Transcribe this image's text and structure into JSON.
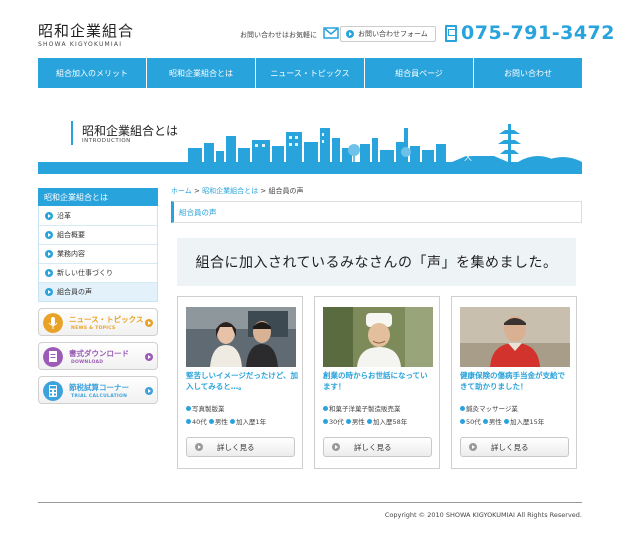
{
  "header": {
    "logo_jp": "昭和企業組合",
    "logo_en": "SHOWA KIGYOKUMIAI",
    "inquiry_text": "お問い合わせはお気軽に",
    "form_button": "お問い合わせフォーム",
    "phone": "075-791-3472"
  },
  "nav": [
    "組合加入のメリット",
    "昭和企業組合とは",
    "ニュース・トピックス",
    "組合員ページ",
    "お問い合わせ"
  ],
  "banner": {
    "title": "昭和企業組合とは",
    "subtitle": "INTRODUCTION",
    "mark": "大"
  },
  "sidebar": {
    "heading": "昭和企業組合とは",
    "items": [
      "沿革",
      "組合概要",
      "業務内容",
      "新しい仕事づくり",
      "組合員の声"
    ],
    "banners": [
      {
        "title": "ニュース・トピックス",
        "sub": "NEWS & TOPICS",
        "color": "#e8a225",
        "icon": "microphone-icon"
      },
      {
        "title": "書式ダウンロード",
        "sub": "DOWNLOAD",
        "color": "#9b5bb7",
        "icon": "document-download-icon"
      },
      {
        "title": "節税試算コーナー",
        "sub": "TRIAL CALCULATION",
        "color": "#3ba2dc",
        "icon": "calculator-icon"
      }
    ]
  },
  "breadcrumb": {
    "home": "ホーム",
    "sep1": ">",
    "parent": "昭和企業組合とは",
    "sep2": ">",
    "current": "組合員の声"
  },
  "section_heading": "組合員の声",
  "catch": "組合に加入されているみなさんの「声」を集めました。",
  "cards": [
    {
      "title": "堅苦しいイメージだったけど、加入してみると…。",
      "business": "写真製版業",
      "age": "40代",
      "gender": "男性",
      "membership": "加入歴1年",
      "button": "詳しく見る"
    },
    {
      "title": "創業の時からお世話になっています！",
      "business": "和菓子洋菓子製造販売業",
      "age": "30代",
      "gender": "男性",
      "membership": "加入歴58年",
      "button": "詳しく見る"
    },
    {
      "title": "健康保険の傷病手当金が支給できて助かりました！",
      "business": "鍼灸マッサージ業",
      "age": "50代",
      "gender": "男性",
      "membership": "加入歴15年",
      "button": "詳しく見る"
    }
  ],
  "footer": {
    "copyright": "Copyright © 2010 SHOWA KIGYOKUMIAI All Rights Reserved."
  },
  "colors": {
    "accent": "#29a3dc"
  }
}
